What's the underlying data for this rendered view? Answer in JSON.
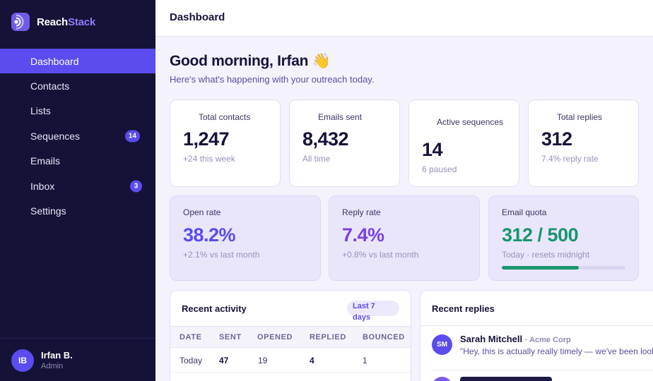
{
  "brand": {
    "name_primary": "Reach",
    "name_accent": "Stack",
    "logo_icon": "broadcast-icon"
  },
  "nav": {
    "items": [
      {
        "label": "Dashboard",
        "active": true
      },
      {
        "label": "Contacts"
      },
      {
        "label": "Lists"
      },
      {
        "label": "Sequences",
        "badge": "14"
      },
      {
        "label": "Emails"
      },
      {
        "label": "Inbox",
        "badge": "3"
      },
      {
        "label": "Settings"
      }
    ]
  },
  "user": {
    "initials": "IB",
    "name": "Irfan B.",
    "role": "Admin"
  },
  "topbar": {
    "title": "Dashboard"
  },
  "greeting": {
    "title": "Good morning, Irfan 👋",
    "subtitle": "Here's what's happening with your outreach today."
  },
  "stats": [
    {
      "label": "Total contacts",
      "value": "1,247",
      "meta": "+24 this week"
    },
    {
      "label": "Emails sent",
      "value": "8,432",
      "meta": "All time"
    },
    {
      "label": "Active sequences",
      "value": "14",
      "meta": "6 paused"
    },
    {
      "label": "Total replies",
      "value": "312",
      "meta": "7.4% reply rate"
    }
  ],
  "metrics": [
    {
      "label": "Open rate",
      "value": "38.2%",
      "meta": "+2.1% vs last month",
      "color": "#5b4cf0"
    },
    {
      "label": "Reply rate",
      "value": "7.4%",
      "meta": "+0.8% vs last month",
      "color": "#7b3fe4"
    },
    {
      "label": "Email quota",
      "value": "312 / 500",
      "meta": "Today · resets midnight",
      "color": "#17966c",
      "progress": 0.624
    }
  ],
  "activity": {
    "title": "Recent activity",
    "range": "Last 7 days",
    "columns": [
      "DATE",
      "SENT",
      "OPENED",
      "REPLIED",
      "BOUNCED"
    ],
    "rows": [
      [
        "Today",
        "47",
        "19",
        "4",
        "1"
      ]
    ]
  },
  "replies": {
    "title": "Recent replies",
    "items": [
      {
        "initials": "SM",
        "name": "Sarah Mitchell",
        "company": "· Acme Corp",
        "text": "\"Hey, this is actually really timely — we've been look"
      }
    ]
  },
  "colors": {
    "sidebar_bg": "#151238",
    "accent": "#5b4cf0",
    "success": "#17966c",
    "page_bg": "#f3f2fd"
  }
}
